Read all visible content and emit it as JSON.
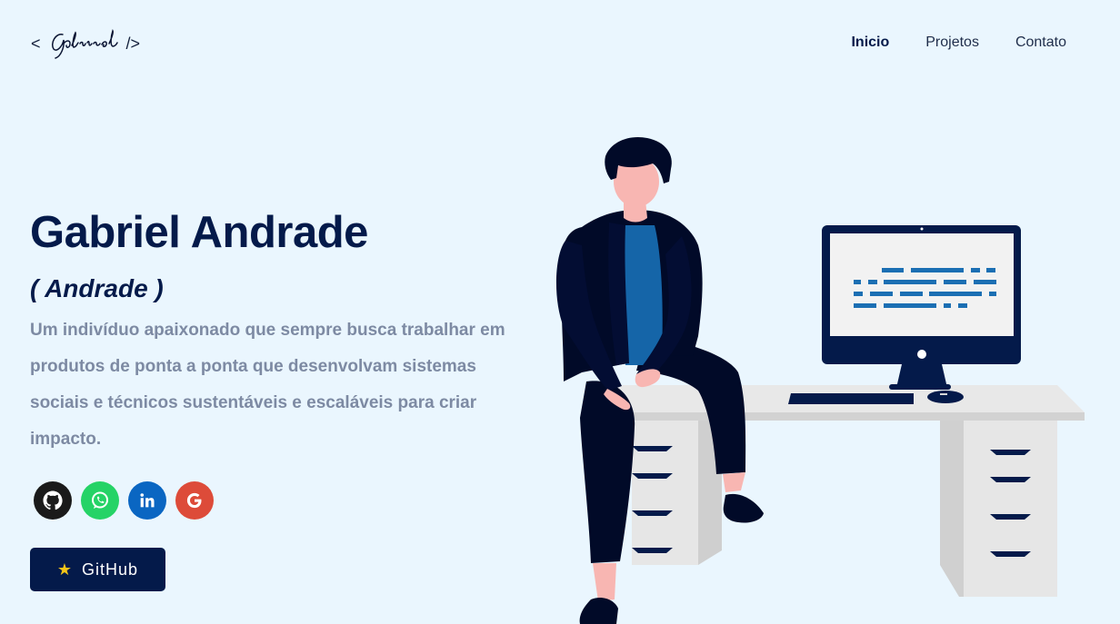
{
  "logo": {
    "open": "<",
    "signature": "Gabriel",
    "close": "/>"
  },
  "nav": {
    "items": [
      {
        "label": "Inicio",
        "active": true
      },
      {
        "label": "Projetos",
        "active": false
      },
      {
        "label": "Contato",
        "active": false
      }
    ]
  },
  "hero": {
    "name": "Gabriel Andrade",
    "nickname": "( Andrade )",
    "bio": "Um indivíduo apaixonado que sempre busca trabalhar em produtos de ponta a ponta que desenvolvam sistemas sociais e técnicos sustentáveis e escaláveis para criar impacto."
  },
  "social": [
    {
      "icon": "github-icon",
      "color": "#1a1a1a"
    },
    {
      "icon": "whatsapp-icon",
      "color": "#25d366"
    },
    {
      "icon": "linkedin-icon",
      "color": "#0a66c2"
    },
    {
      "icon": "google-icon",
      "color": "#dd4b39"
    }
  ],
  "github_button": {
    "label": "GitHub",
    "icon": "star-icon"
  },
  "colors": {
    "background": "#eaf6fe",
    "primary": "#041a4a",
    "text_muted": "#7d8aa3",
    "accent": "#1565c0"
  }
}
